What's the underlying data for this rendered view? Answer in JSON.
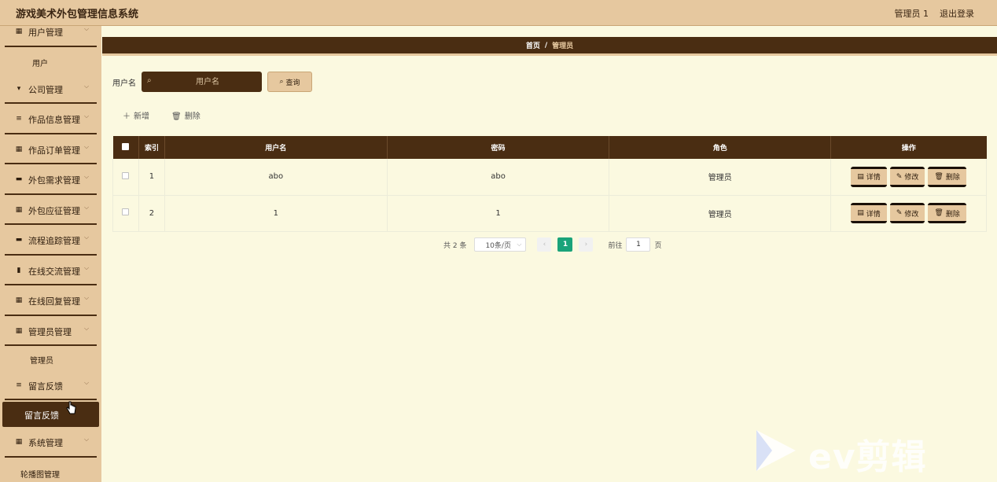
{
  "header": {
    "title": "游戏美术外包管理信息系统",
    "user": "管理员 1",
    "logout": "退出登录"
  },
  "sidebar": {
    "items": [
      {
        "icon": "grid-icon",
        "label": "用户管理"
      },
      {
        "label": "用户"
      },
      {
        "icon": "cup-icon",
        "label": "公司管理"
      },
      {
        "icon": "list-icon",
        "label": "作品信息管理"
      },
      {
        "icon": "grid-icon",
        "label": "作品订单管理"
      },
      {
        "icon": "monitor-icon",
        "label": "外包需求管理"
      },
      {
        "icon": "grid-icon",
        "label": "外包应征管理"
      },
      {
        "icon": "monitor-icon",
        "label": "流程追踪管理"
      },
      {
        "icon": "bar-chart-icon",
        "label": "在线交流管理"
      },
      {
        "icon": "grid-icon",
        "label": "在线回复管理"
      },
      {
        "icon": "grid-icon",
        "label": "管理员管理"
      },
      {
        "label": "管理员"
      },
      {
        "icon": "list-icon",
        "label": "留言反馈"
      },
      {
        "label": "留言反馈"
      },
      {
        "icon": "grid-icon",
        "label": "系统管理"
      },
      {
        "label": "轮播图管理"
      }
    ]
  },
  "breadcrumb": {
    "home": "首页",
    "separator": "/",
    "current": "管理员"
  },
  "search": {
    "label": "用户名",
    "placeholder": "用户名",
    "button": "查询"
  },
  "toolbar": {
    "add": "新增",
    "delete": "删除"
  },
  "table": {
    "headers": [
      "索引",
      "用户名",
      "密码",
      "角色",
      "操作"
    ],
    "rows": [
      {
        "index": "1",
        "username": "abo",
        "password": "abo",
        "role": "管理员"
      },
      {
        "index": "2",
        "username": "1",
        "password": "1",
        "role": "管理员"
      }
    ],
    "actions": {
      "detail": "详情",
      "edit": "修改",
      "delete": "删除"
    }
  },
  "pagination": {
    "total": "共 2 条",
    "page_size": "10条/页",
    "current_page": "1",
    "goto_label": "前往",
    "goto_value": "1",
    "page_unit": "页"
  },
  "watermark": {
    "text": "ev剪辑"
  },
  "colors": {
    "primary": "#4a2d12",
    "accent": "#e6c89f",
    "background": "#fbf9e0",
    "active_page": "#1aa37a"
  }
}
